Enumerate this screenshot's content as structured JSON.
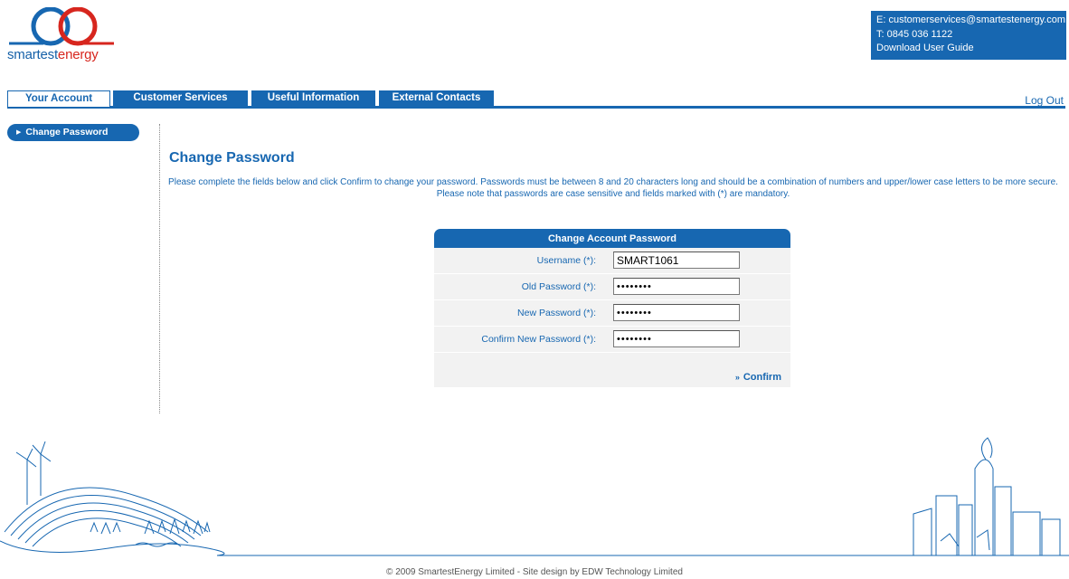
{
  "brand": {
    "logo_part1": "smartest",
    "logo_part2": "energy",
    "primary": "#1767b1",
    "accent": "#d7261e"
  },
  "contact": {
    "email_line": "E: customerservices@smartestenergy.com",
    "phone_line": "T: 0845 036 1122",
    "guide_link": "Download User Guide"
  },
  "tabs": [
    {
      "label": "Your Account",
      "active": true
    },
    {
      "label": "Customer Services",
      "active": false
    },
    {
      "label": "Useful Information",
      "active": false
    },
    {
      "label": "External Contacts",
      "active": false
    }
  ],
  "logout_label": "Log Out",
  "sidebar": {
    "items": [
      {
        "label": "Change Password",
        "icon": "triangle-right-icon"
      }
    ]
  },
  "page": {
    "title": "Change Password",
    "description": "Please complete the fields below and click Confirm to change your password. Passwords must be between 8 and 20 characters long and should be a combination of numbers and upper/lower case letters to be more secure. Please note that passwords are case sensitive and fields marked with (*) are mandatory."
  },
  "form": {
    "header": "Change Account Password",
    "fields": [
      {
        "label": "Username (*):",
        "value": "SMART1061",
        "type": "text"
      },
      {
        "label": "Old Password (*):",
        "value": "••••••••",
        "type": "password"
      },
      {
        "label": "New Password (*):",
        "value": "••••••••",
        "type": "password"
      },
      {
        "label": "Confirm New Password (*):",
        "value": "••••••••",
        "type": "password"
      }
    ],
    "confirm_label": "Confirm"
  },
  "footer": {
    "copyright": "© 2009 SmartestEnergy Limited - Site design by EDW Technology Limited"
  }
}
